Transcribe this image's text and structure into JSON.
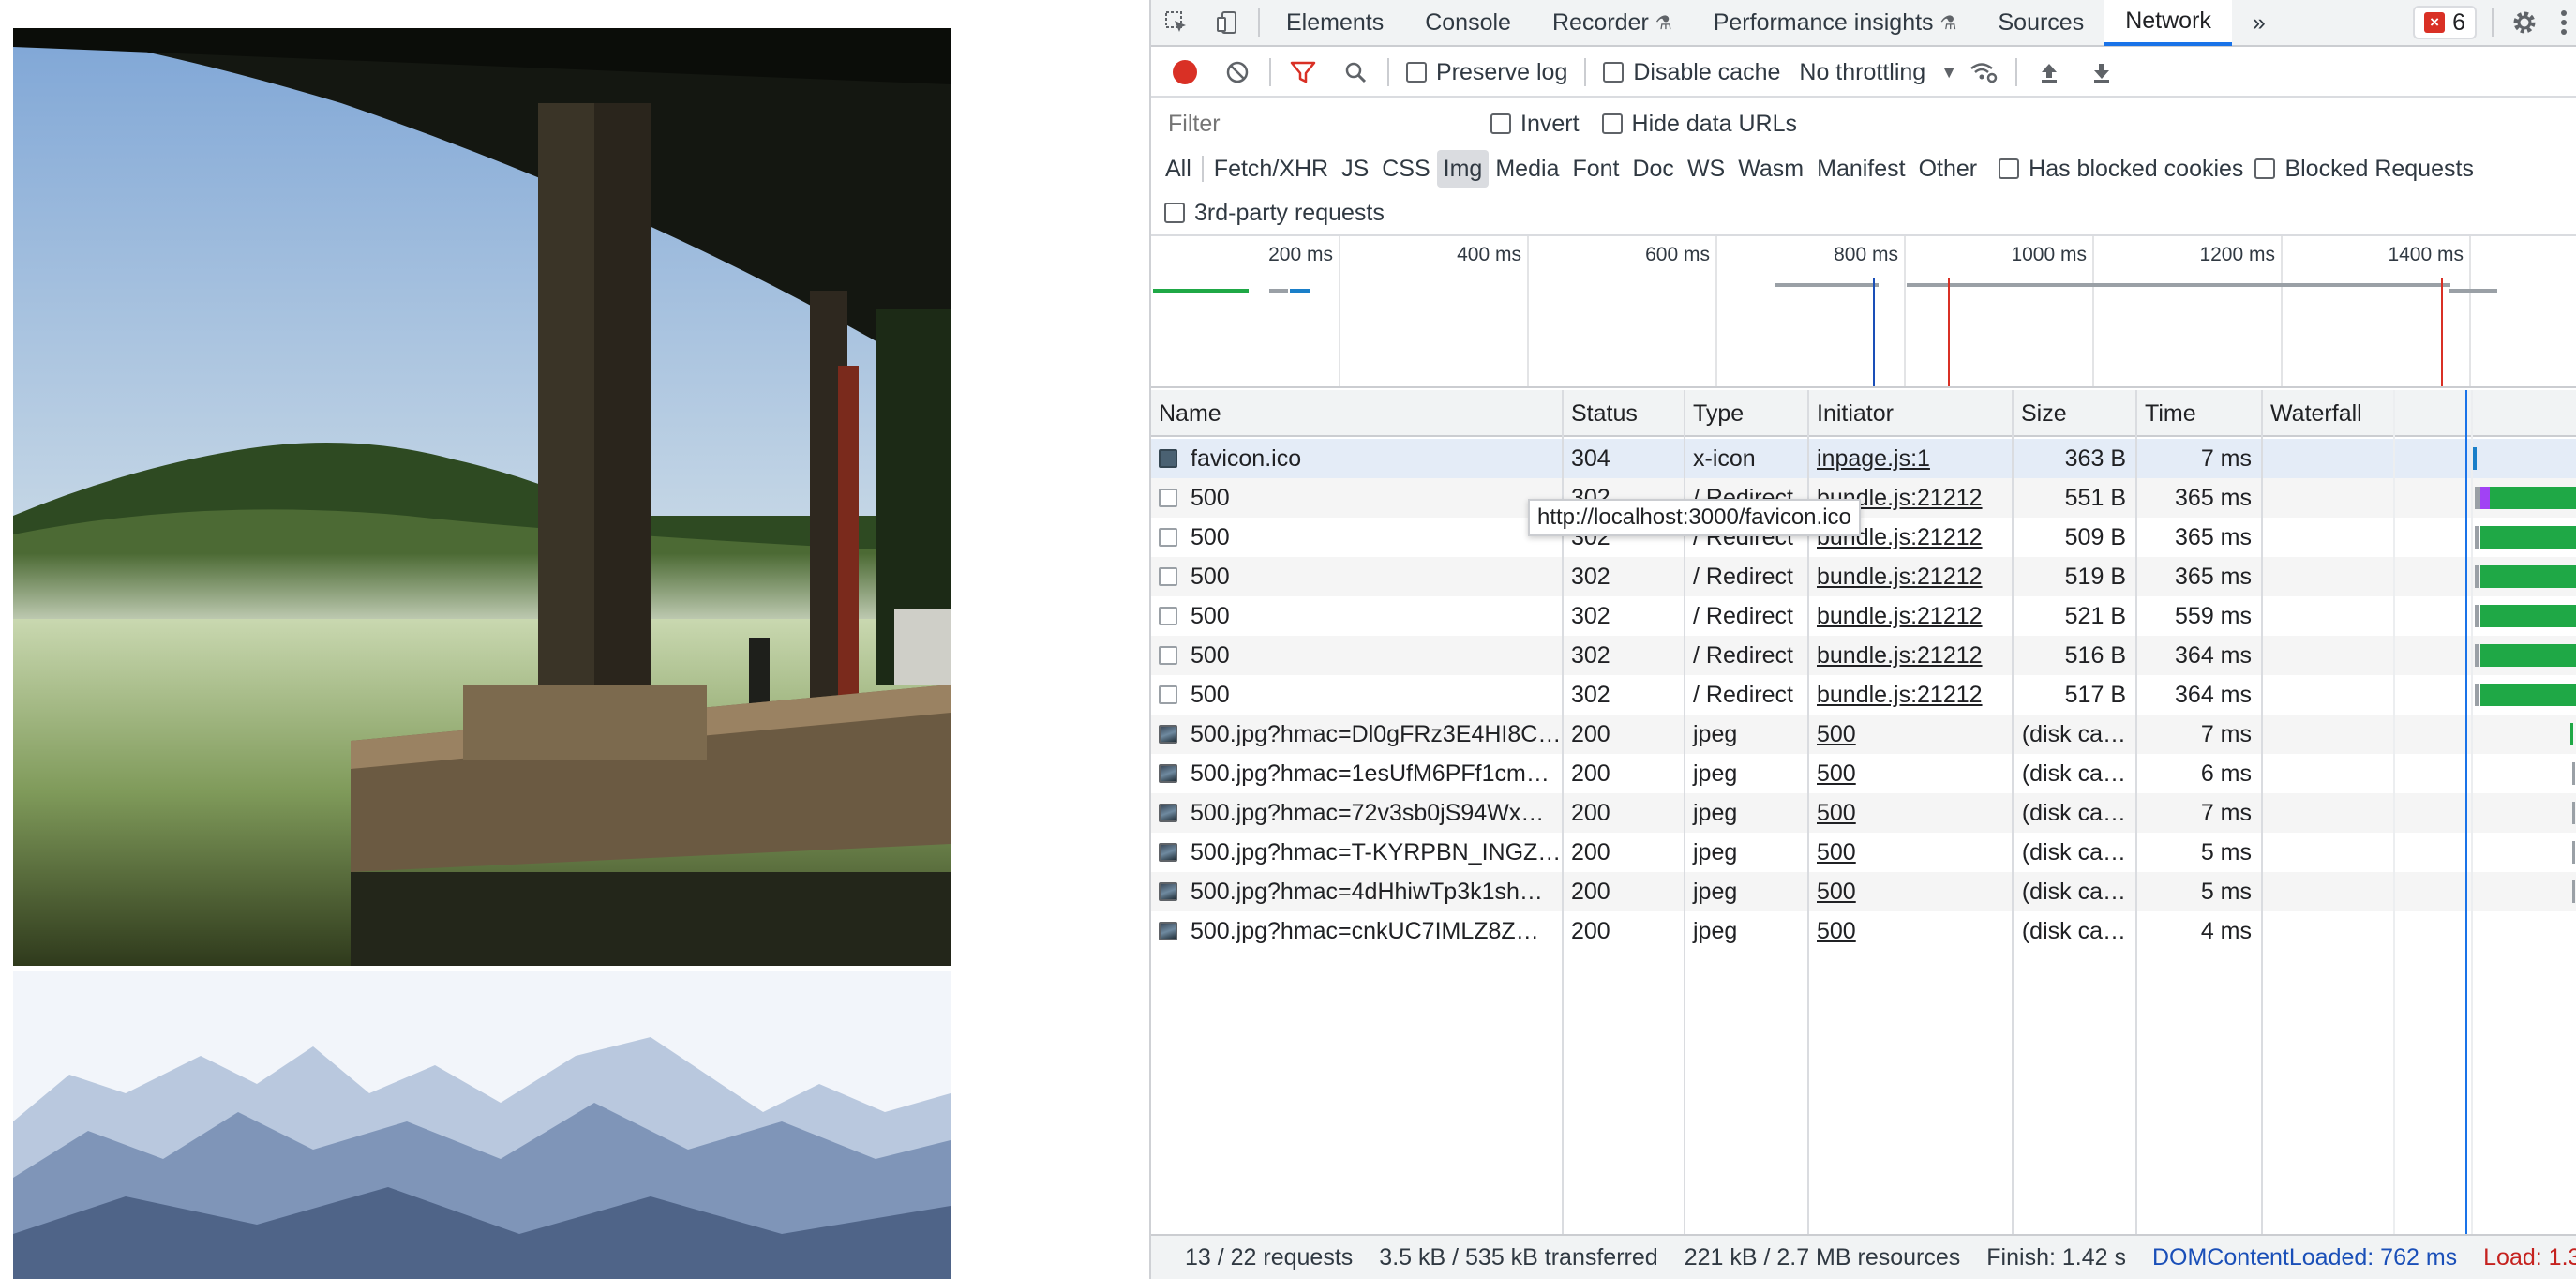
{
  "tabs": {
    "elements": "Elements",
    "console": "Console",
    "recorder": "Recorder",
    "performance": "Performance insights",
    "sources": "Sources",
    "network": "Network",
    "more": "»",
    "error_count": "6"
  },
  "toolbar": {
    "preserve_log": "Preserve log",
    "disable_cache": "Disable cache",
    "throttling": "No throttling"
  },
  "filter": {
    "placeholder": "Filter",
    "invert": "Invert",
    "hide_data_urls": "Hide data URLs",
    "types": [
      "All",
      "Fetch/XHR",
      "JS",
      "CSS",
      "Img",
      "Media",
      "Font",
      "Doc",
      "WS",
      "Wasm",
      "Manifest",
      "Other"
    ],
    "active_type": "Img",
    "has_blocked_cookies": "Has blocked cookies",
    "blocked_requests": "Blocked Requests",
    "third_party": "3rd-party requests"
  },
  "overview": {
    "ticks": [
      "200 ms",
      "400 ms",
      "600 ms",
      "800 ms",
      "1000 ms",
      "1200 ms",
      "1400 ms"
    ]
  },
  "table": {
    "headers": [
      "Name",
      "Status",
      "Type",
      "Initiator",
      "Size",
      "Time",
      "Waterfall"
    ],
    "rows": [
      {
        "icon": "ico",
        "name": "favicon.ico",
        "status": "304",
        "type": "x-icon",
        "initiator": "inpage.js:1",
        "size": "363 B",
        "time": "7 ms"
      },
      {
        "icon": "doc",
        "name": "500",
        "status": "302",
        "type": "/ Redirect",
        "initiator": "bundle.js:21212",
        "size": "551 B",
        "time": "365 ms"
      },
      {
        "icon": "doc",
        "name": "500",
        "status": "302",
        "type": "/ Redirect",
        "initiator": "bundle.js:21212",
        "size": "509 B",
        "time": "365 ms"
      },
      {
        "icon": "doc",
        "name": "500",
        "status": "302",
        "type": "/ Redirect",
        "initiator": "bundle.js:21212",
        "size": "519 B",
        "time": "365 ms"
      },
      {
        "icon": "doc",
        "name": "500",
        "status": "302",
        "type": "/ Redirect",
        "initiator": "bundle.js:21212",
        "size": "521 B",
        "time": "559 ms"
      },
      {
        "icon": "doc",
        "name": "500",
        "status": "302",
        "type": "/ Redirect",
        "initiator": "bundle.js:21212",
        "size": "516 B",
        "time": "364 ms"
      },
      {
        "icon": "doc",
        "name": "500",
        "status": "302",
        "type": "/ Redirect",
        "initiator": "bundle.js:21212",
        "size": "517 B",
        "time": "364 ms"
      },
      {
        "icon": "img",
        "name": "500.jpg?hmac=Dl0gFRz3E4HI8C…",
        "status": "200",
        "type": "jpeg",
        "initiator": "500",
        "size": "(disk ca…",
        "time": "7 ms"
      },
      {
        "icon": "img",
        "name": "500.jpg?hmac=1esUfM6PFf1cm…",
        "status": "200",
        "type": "jpeg",
        "initiator": "500",
        "size": "(disk ca…",
        "time": "6 ms"
      },
      {
        "icon": "img",
        "name": "500.jpg?hmac=72v3sb0jS94Wx…",
        "status": "200",
        "type": "jpeg",
        "initiator": "500",
        "size": "(disk ca…",
        "time": "7 ms"
      },
      {
        "icon": "img",
        "name": "500.jpg?hmac=T-KYRPBN_INGZ…",
        "status": "200",
        "type": "jpeg",
        "initiator": "500",
        "size": "(disk ca…",
        "time": "5 ms"
      },
      {
        "icon": "img",
        "name": "500.jpg?hmac=4dHhiwTp3k1sh…",
        "status": "200",
        "type": "jpeg",
        "initiator": "500",
        "size": "(disk ca…",
        "time": "5 ms"
      },
      {
        "icon": "img",
        "name": "500.jpg?hmac=cnkUC7IMLZ8Z…",
        "status": "200",
        "type": "jpeg",
        "initiator": "500",
        "size": "(disk ca…",
        "time": "4 ms"
      }
    ]
  },
  "tooltip": "http://localhost:3000/favicon.ico",
  "status": {
    "requests": "13 / 22 requests",
    "transferred": "3.5 kB / 535 kB transferred",
    "resources": "221 kB / 2.7 MB resources",
    "finish": "Finish: 1.42 s",
    "dom": "DOMContentLoaded: 762 ms",
    "load": "Load: 1.3"
  },
  "colors": {
    "accent": "#1a73e8",
    "record": "#d93025",
    "waterfall_green": "#1fa846",
    "dom_line": "#1a4fb8",
    "load_line": "#d93025"
  }
}
